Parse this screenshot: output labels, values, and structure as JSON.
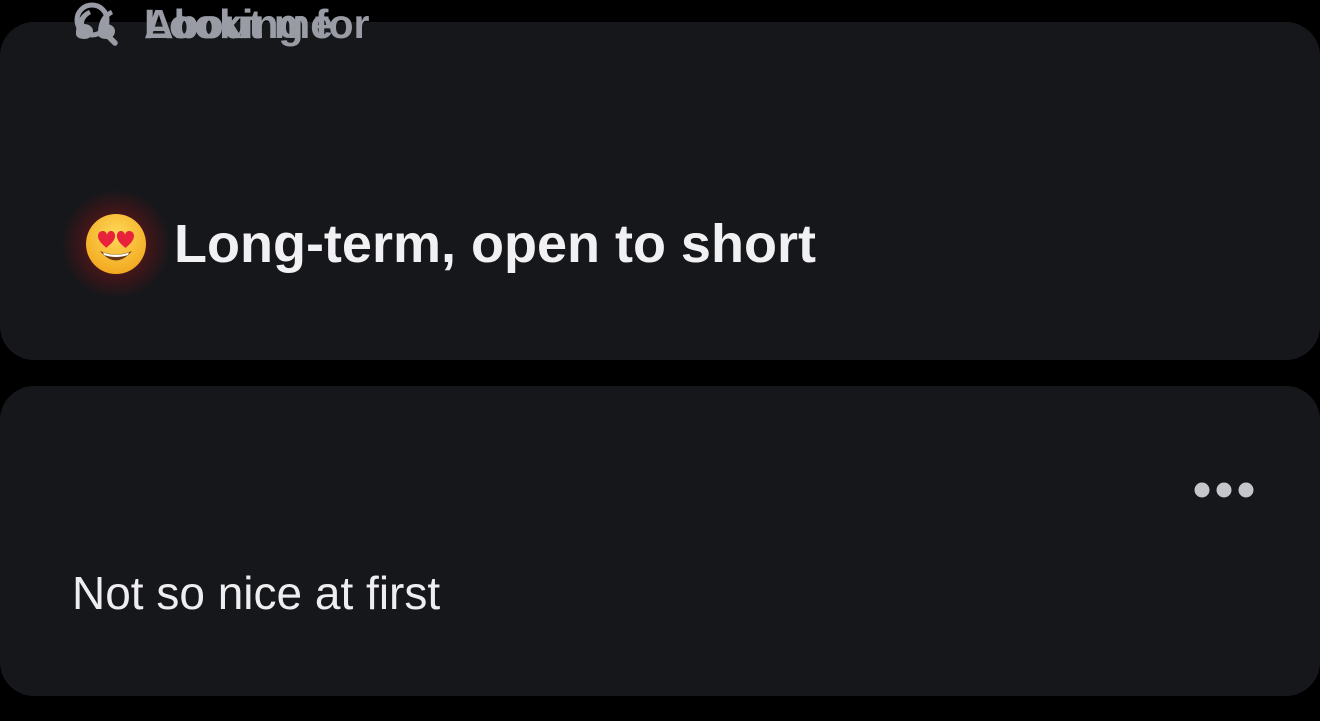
{
  "looking_for": {
    "header_label": "Looking for",
    "header_icon": "search-icon",
    "emoji_icon": "heart-eyes-emoji-icon",
    "value": "Long-term, open to short"
  },
  "about_me": {
    "header_label": "About me",
    "header_icon": "quote-icon",
    "menu_icon": "more-options-icon",
    "text": "Not so nice at first"
  },
  "colors": {
    "page_background": "#000000",
    "card_background": "#16171b",
    "muted_text": "#9a9ca5",
    "primary_text": "#f1f1f3"
  }
}
